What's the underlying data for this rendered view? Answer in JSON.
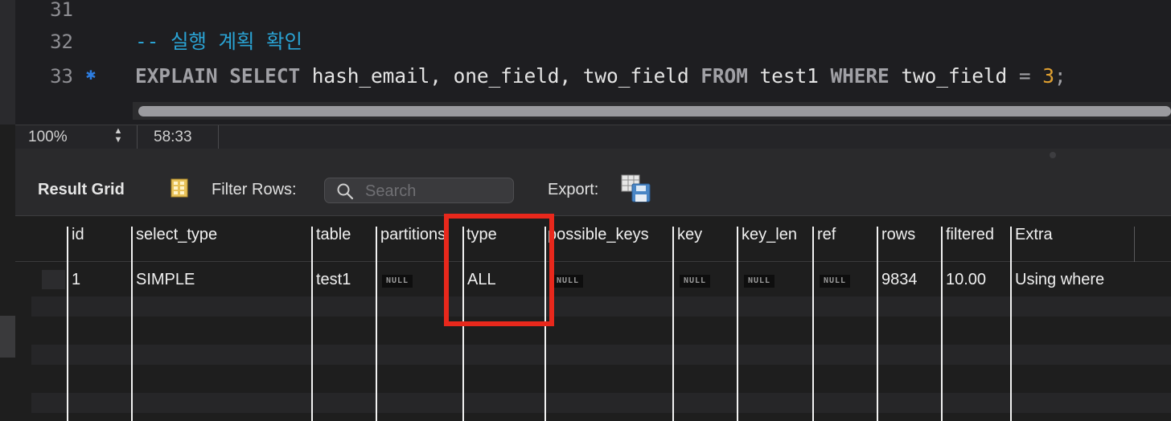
{
  "editor": {
    "lines": [
      {
        "number": "31",
        "marker": false,
        "text": ""
      },
      {
        "number": "32",
        "marker": false,
        "text": "-- 실행 계획 확인"
      },
      {
        "number": "33",
        "marker": true,
        "text": "EXPLAIN SELECT hash_email, one_field, two_field FROM test1 WHERE two_field = 3;"
      }
    ],
    "tokens": {
      "explain": "EXPLAIN",
      "select": "SELECT",
      "columns": "hash_email, one_field, two_field",
      "from": "FROM",
      "table": "test1",
      "where": "WHERE",
      "field": "two_field",
      "op": "=",
      "value": "3",
      "end": ";"
    }
  },
  "statusbar": {
    "zoom": "100%",
    "position": "58:33"
  },
  "toolbar": {
    "result_grid_label": "Result Grid",
    "filter_rows_label": "Filter Rows:",
    "search_placeholder": "Search",
    "export_label": "Export:"
  },
  "grid": {
    "columns": [
      "id",
      "select_type",
      "table",
      "partitions",
      "type",
      "possible_keys",
      "key",
      "key_len",
      "ref",
      "rows",
      "filtered",
      "Extra"
    ],
    "rows": [
      {
        "id": "1",
        "select_type": "SIMPLE",
        "table": "test1",
        "partitions": "NULL",
        "type": "ALL",
        "possible_keys": "NULL",
        "key": "NULL",
        "key_len": "NULL",
        "ref": "NULL",
        "rows": "9834",
        "filtered": "10.00",
        "Extra": "Using where"
      }
    ]
  },
  "colors": {
    "highlight": "#e8281c",
    "comment": "#2aa3d4",
    "number_literal": "#e0a030",
    "keyword": "#a0a0a5"
  }
}
